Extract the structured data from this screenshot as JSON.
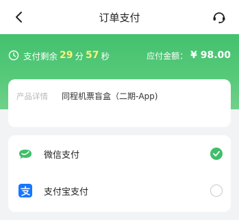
{
  "header": {
    "title": "订单支付",
    "back_icon": "chevron-left-icon",
    "service_icon": "customer-service-icon"
  },
  "countdown": {
    "prefix": "支付剩余",
    "minutes": "29",
    "min_unit": "分",
    "seconds": "57",
    "sec_unit": "秒",
    "icon": "clock-icon"
  },
  "amount": {
    "label": "应付金额：",
    "value": "¥ 98.00"
  },
  "product": {
    "label": "产品详情",
    "value": "同程机票盲盒（二期-App)"
  },
  "payment": {
    "methods": [
      {
        "name": "微信支付",
        "icon": "wechat-pay-icon",
        "selected": true
      },
      {
        "name": "支付宝支付",
        "icon": "alipay-icon",
        "selected": false
      }
    ]
  },
  "colors": {
    "accent_green": "#43c16e",
    "countdown_highlight": "#fff27a",
    "wechat_green": "#3fbf6b",
    "alipay_blue": "#1677ff"
  }
}
